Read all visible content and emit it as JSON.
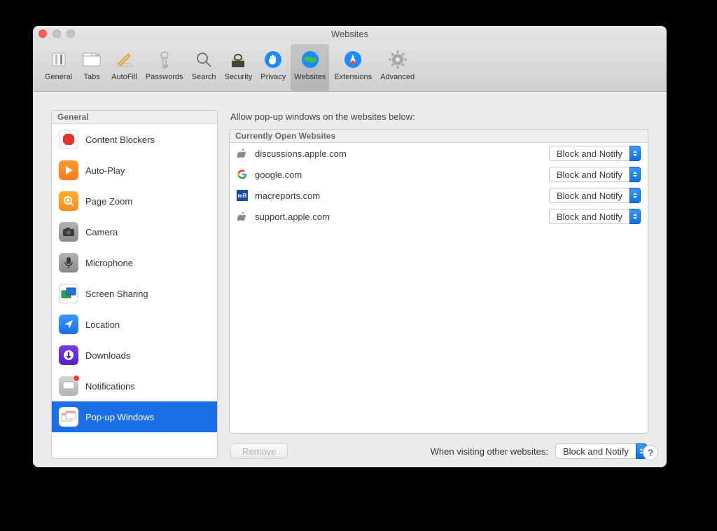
{
  "window": {
    "title": "Websites"
  },
  "toolbar": {
    "items": [
      {
        "label": "General"
      },
      {
        "label": "Tabs"
      },
      {
        "label": "AutoFill"
      },
      {
        "label": "Passwords"
      },
      {
        "label": "Search"
      },
      {
        "label": "Security"
      },
      {
        "label": "Privacy"
      },
      {
        "label": "Websites"
      },
      {
        "label": "Extensions"
      },
      {
        "label": "Advanced"
      }
    ]
  },
  "sidebar": {
    "header": "General",
    "items": [
      {
        "label": "Content Blockers"
      },
      {
        "label": "Auto-Play"
      },
      {
        "label": "Page Zoom"
      },
      {
        "label": "Camera"
      },
      {
        "label": "Microphone"
      },
      {
        "label": "Screen Sharing"
      },
      {
        "label": "Location"
      },
      {
        "label": "Downloads"
      },
      {
        "label": "Notifications"
      },
      {
        "label": "Pop-up Windows"
      }
    ]
  },
  "main": {
    "heading": "Allow pop-up windows on the websites below:",
    "panel_header": "Currently Open Websites",
    "sites": [
      {
        "domain": "discussions.apple.com",
        "value": "Block and Notify"
      },
      {
        "domain": "google.com",
        "value": "Block and Notify"
      },
      {
        "domain": "macreports.com",
        "value": "Block and Notify"
      },
      {
        "domain": "support.apple.com",
        "value": "Block and Notify"
      }
    ],
    "remove_label": "Remove",
    "default_label": "When visiting other websites:",
    "default_value": "Block and Notify"
  },
  "help": "?"
}
